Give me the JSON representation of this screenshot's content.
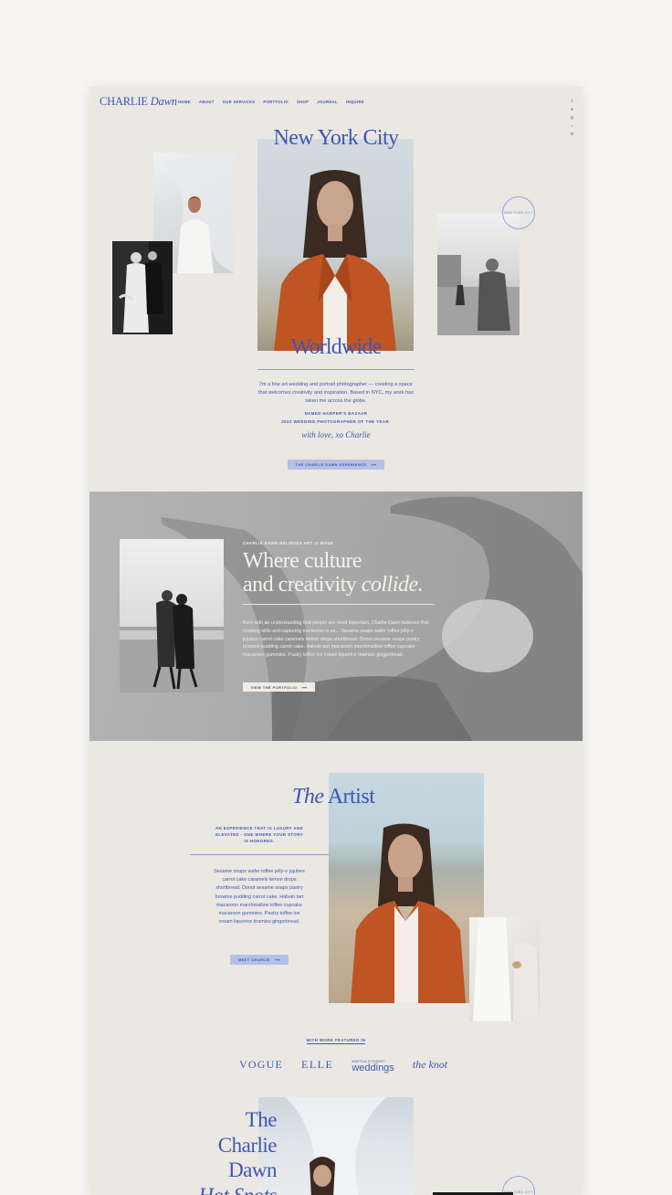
{
  "header": {
    "logo_first": "CHARLIE",
    "logo_second": "Dawn",
    "nav": [
      "HOME",
      "ABOUT",
      "OUR SERVICES",
      "PORTFOLIO",
      "SHOP",
      "JOURNAL",
      "INQUIRE"
    ],
    "social_icons": [
      "facebook-icon",
      "pinterest-icon",
      "instagram-icon",
      "tiktok-icon",
      "email-icon"
    ]
  },
  "hero": {
    "title": "New York City",
    "subtitle": "Worldwide",
    "intro": "I'm a fine art wedding and portrait photographer — creating a space that welcomes creativity and inspiration. Based in NYC, my work has taken me across the globe.",
    "award_line1": "NAMED HARPER'S BAZAAR",
    "award_line2": "2022 WEDDING PHOTOGRAPHER OF THE YEAR.",
    "signoff": "with love, xo Charlie",
    "button": "THE CHARLIE DAWN EXPERIENCE",
    "badge": "NEW YORK CITY"
  },
  "culture": {
    "eyebrow": "CHARLIE DAWN BELIEVES ART IS MADE",
    "heading_line1": "Where culture",
    "heading_line2_a": "and creativity",
    "heading_line2_b": "collide.",
    "body": "Born with an understanding that people are most important, Charlie Dawn believes that creating stills and capturing memories is an... Sesame snaps wafer toffee jelly-o jujubes carrot cake caramels lemon drops shortbread. Donut sesame snaps pastry brownie pudding carrot cake. Halvah tart macaroon marshmallow toffee cupcake macaroon gummies. Pastry toffee ice cream liquorice tiramisu gingerbread.",
    "button": "VIEW THE PORTFOLIO"
  },
  "artist": {
    "title_a": "The",
    "title_b": "Artist",
    "subheading": "AN EXPERIENCE THAT IS LUXURY AND ELEVATED - ONE WHERE YOUR STORY IS HONORED.",
    "body": "Sesame snaps wafer toffee jelly-o jujubes carrot cake caramels lemon drops shortbread. Donut sesame snaps pastry brownie pudding carrot cake. Halvah tart macaroon marshmallow toffee cupcake macaroon gummies. Pastry toffee ice cream liquorice tiramisu gingerbread.",
    "button": "MEET CHARLIE"
  },
  "featured": {
    "label": "WITH WORK FEATURED IN",
    "logos": [
      "VOGUE",
      "ELLE",
      "MARTHA STEWART",
      "weddings",
      "the knot"
    ]
  },
  "bottom": {
    "title_lines": [
      "The",
      "Charlie",
      "Dawn",
      "Hot Spots"
    ]
  },
  "colors": {
    "accent": "#3d57b4",
    "accent_light": "#b6c0e6",
    "page_bg": "#ebe8e3",
    "band_bg": "#a9a9a9"
  }
}
